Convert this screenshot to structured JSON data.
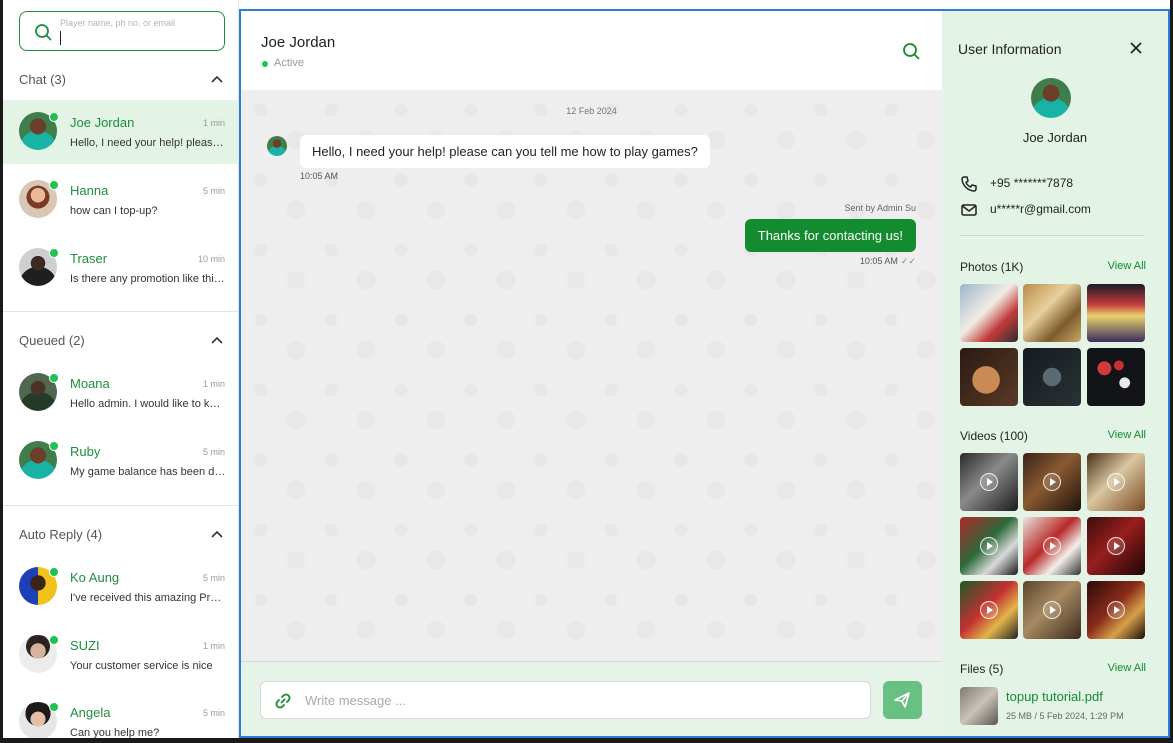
{
  "sidebar": {
    "search_placeholder": "Player name, ph no. or email",
    "sections": {
      "chat": {
        "label": "Chat (3)",
        "items": [
          {
            "name": "Joe Jordan",
            "time": "1 min",
            "message": "Hello, I need your help! please can you tell me how to play games?"
          },
          {
            "name": "Hanna",
            "time": "5 min",
            "message": "how can I top-up?"
          },
          {
            "name": "Traser",
            "time": "10 min",
            "message": "Is there any promotion like this month?"
          }
        ]
      },
      "queued": {
        "label": "Queued (2)",
        "items": [
          {
            "name": "Moana",
            "time": "1 min",
            "message": "Hello admin. I would like to know more"
          },
          {
            "name": "Ruby",
            "time": "5 min",
            "message": "My game balance has been deducted"
          }
        ]
      },
      "auto_reply": {
        "label": "Auto Reply (4)",
        "items": [
          {
            "name": "Ko Aung",
            "time": "5 min",
            "message": "I've received this amazing Promotion"
          },
          {
            "name": "SUZI",
            "time": "1 min",
            "message": "Your customer service is nice"
          },
          {
            "name": "Angela",
            "time": "5 min",
            "message": "Can you help me?"
          }
        ]
      }
    }
  },
  "chat": {
    "header": {
      "name": "Joe Jordan",
      "status": "Active"
    },
    "date": "12 Feb 2024",
    "incoming": {
      "text": "Hello, I need your help! please can you tell me how to play games?",
      "time": "10:05 AM"
    },
    "outgoing": {
      "sent_by": "Sent by Admin Su",
      "text": "Thanks for contacting us!",
      "time": "10:05 AM"
    },
    "composer": {
      "placeholder": "Write message ..."
    }
  },
  "info": {
    "title": "User Information",
    "name": "Joe Jordan",
    "phone": "+95 *******7878",
    "email": "u*****r@gmail.com",
    "photos_label": "Photos (1K)",
    "videos_label": "Videos (100)",
    "files_label": "Files (5)",
    "view_all": "View All",
    "file": {
      "name": "topup tutorial.pdf",
      "meta": "25 MB / 5 Feb 2024, 1:29 PM"
    }
  },
  "colors": {
    "accent": "#128c2e",
    "active_bg": "#e3f3e6",
    "online": "#20c153",
    "frame": "#2a7fd4"
  }
}
